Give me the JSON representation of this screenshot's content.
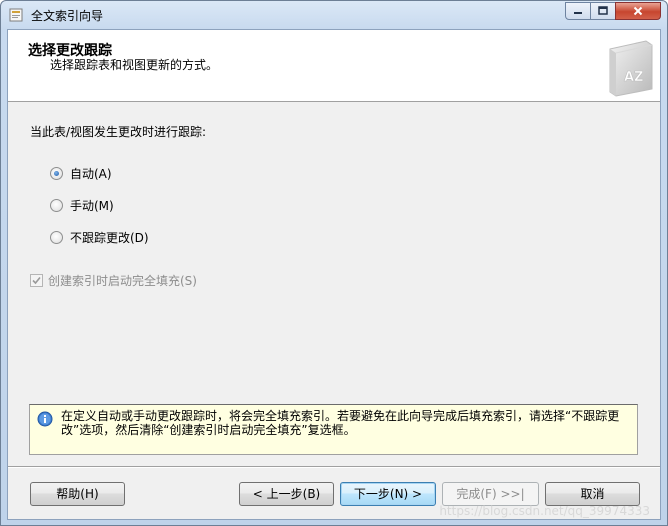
{
  "window": {
    "title": "全文索引向导"
  },
  "header": {
    "title": "选择更改跟踪",
    "subtitle": "选择跟踪表和视图更新的方式。",
    "book_icon_letters": "AZ"
  },
  "content": {
    "prompt": "当此表/视图发生更改时进行跟踪:",
    "options": [
      {
        "label": "自动(A)",
        "selected": true
      },
      {
        "label": "手动(M)",
        "selected": false
      },
      {
        "label": "不跟踪更改(D)",
        "selected": false
      }
    ],
    "full_population": {
      "label": "创建索引时启动完全填充(S)",
      "checked": true,
      "enabled": false
    }
  },
  "info": {
    "text": "在定义自动或手动更改跟踪时，将会完全填充索引。若要避免在此向导完成后填充索引，请选择“不跟踪更改”选项，然后清除“创建索引时启动完全填充”复选框。"
  },
  "buttons": {
    "help": "帮助(H)",
    "back": "< 上一步(B)",
    "next": "下一步(N) >",
    "finish": "完成(F) >>|",
    "cancel": "取消"
  },
  "watermark": "https://blog.csdn.net/qq_39974333"
}
